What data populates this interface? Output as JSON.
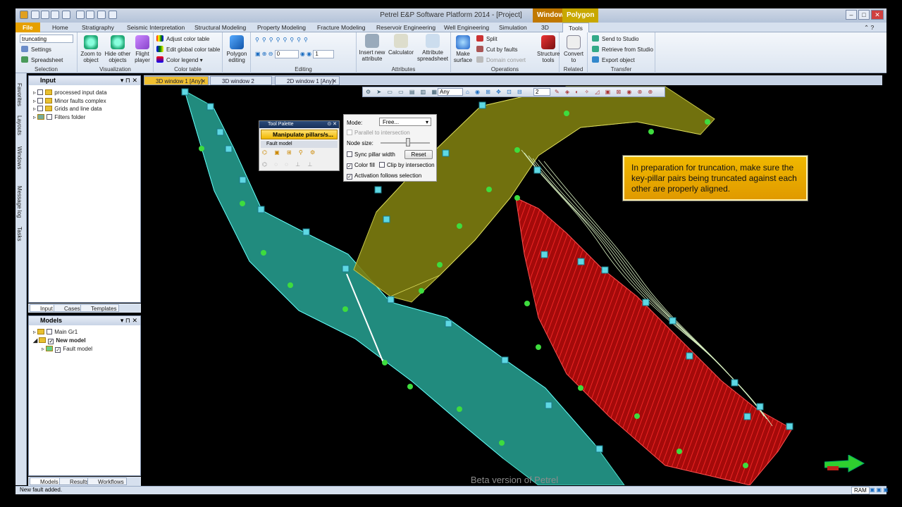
{
  "app": {
    "title": "Petrel E&P Software Platform 2014 - [Project]"
  },
  "context_tabs": [
    "Window",
    "Polygon"
  ],
  "ribbon_tabs": [
    "File",
    "Home",
    "Stratigraphy",
    "Seismic Interpretation",
    "Structural Modeling",
    "Property Modeling",
    "Fracture Modeling",
    "Reservoir Engineering",
    "Well Engineering",
    "Simulation",
    "3D",
    "Tools"
  ],
  "active_tab": "Tools",
  "selection": {
    "search_value": "truncating",
    "items": [
      "Settings",
      "Spreadsheet"
    ],
    "label": "Selection"
  },
  "visualization": {
    "buttons": [
      "Zoom to object",
      "Hide other objects",
      "Flight player"
    ],
    "label": "Visualization"
  },
  "color_table": {
    "items": [
      "Adjust color table",
      "Edit global color table",
      "Color legend"
    ],
    "label": "Color table"
  },
  "polygon": {
    "button": "Polygon editing"
  },
  "editing": {
    "label": "Editing",
    "value1": "0",
    "value2": "1"
  },
  "attributes": {
    "buttons": [
      "Insert new attribute",
      "Calculator",
      "Attribute spreadsheet"
    ],
    "label": "Attributes"
  },
  "operations": {
    "make_surface": "Make surface",
    "items": [
      "Split",
      "Cut by faults",
      "Domain convert"
    ],
    "structure_tools": "Structure tools",
    "label": "Operations"
  },
  "related": {
    "button": "Convert to",
    "label": "Related"
  },
  "transfer": {
    "items": [
      "Send to Studio",
      "Retrieve from Studio",
      "Export object"
    ],
    "label": "Transfer"
  },
  "side_tabs": [
    "Favorites",
    "Layouts",
    "Windows",
    "Message log",
    "Tasks"
  ],
  "input_panel": {
    "title": "Input",
    "items": [
      "processed input data",
      "Minor faults complex",
      "Grids and line data",
      "Filters folder"
    ],
    "tabs": [
      "Input",
      "Cases",
      "Templates"
    ]
  },
  "models_panel": {
    "title": "Models",
    "items": [
      "Main Gr1",
      "New model",
      "Fault model"
    ],
    "tabs": [
      "Models",
      "Results",
      "Workflows"
    ]
  },
  "view_tabs": [
    "3D window 1 [Any]",
    "3D window 2 [Any]",
    "2D window 1 [Any]"
  ],
  "view_toolbar": {
    "domain": "Any",
    "num": "2"
  },
  "tool_palette": {
    "title": "Tool Palette",
    "selected": "Manipulate pillars/s...",
    "section": "Fault model"
  },
  "mode_box": {
    "mode_label": "Mode:",
    "mode_value": "Free...",
    "parallel": "Parallel to intersection",
    "node_size": "Node size:",
    "sync": "Sync pillar width",
    "reset": "Reset",
    "color_fill": "Color fill",
    "clip": "Clip by intersection",
    "activation": "Activation follows selection"
  },
  "callout": {
    "text": "In preparation for truncation, make sure the key-pillar pairs being truncated against each other are properly aligned."
  },
  "watermark": "Beta version of Petrel",
  "status": {
    "text": "New fault added.",
    "ram": "RAM"
  },
  "colors": {
    "file_tab": "#e6a000",
    "window_tab": "#c07800",
    "polygon_tab": "#c8a800",
    "teal": "#2aa89a",
    "olive": "#8a8a10",
    "red": "#c01010",
    "callout": "#f0b000"
  }
}
